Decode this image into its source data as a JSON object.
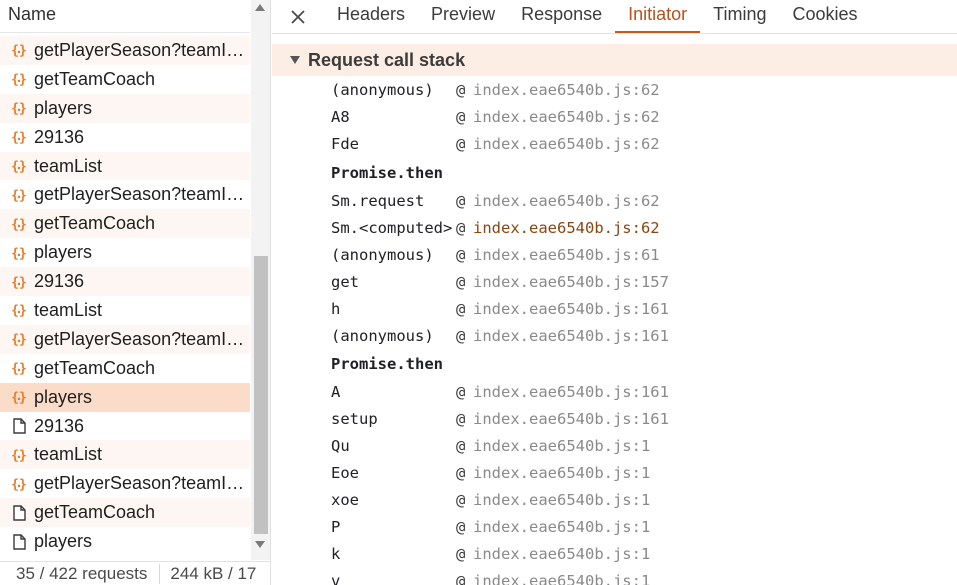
{
  "network": {
    "header": "Name",
    "requests": [
      {
        "name": "getPlayerSeason?teamId...",
        "icon": "json-icon"
      },
      {
        "name": "getTeamCoach",
        "icon": "json-icon"
      },
      {
        "name": "players",
        "icon": "json-icon"
      },
      {
        "name": "29136",
        "icon": "json-icon"
      },
      {
        "name": "teamList",
        "icon": "json-icon"
      },
      {
        "name": "getPlayerSeason?teamId...",
        "icon": "json-icon"
      },
      {
        "name": "getTeamCoach",
        "icon": "json-icon"
      },
      {
        "name": "players",
        "icon": "json-icon"
      },
      {
        "name": "29136",
        "icon": "json-icon"
      },
      {
        "name": "teamList",
        "icon": "json-icon"
      },
      {
        "name": "getPlayerSeason?teamId...",
        "icon": "json-icon"
      },
      {
        "name": "getTeamCoach",
        "icon": "json-icon"
      },
      {
        "name": "players",
        "icon": "json-icon",
        "selected": true
      },
      {
        "name": "29136",
        "icon": "document-icon"
      },
      {
        "name": "teamList",
        "icon": "json-icon"
      },
      {
        "name": "getPlayerSeason?teamId...",
        "icon": "json-icon"
      },
      {
        "name": "getTeamCoach",
        "icon": "document-icon"
      },
      {
        "name": "players",
        "icon": "document-icon"
      }
    ],
    "status": {
      "requests": "35 / 422 requests",
      "transferred": "244 kB / 17"
    }
  },
  "details": {
    "tabs": [
      "Headers",
      "Preview",
      "Response",
      "Initiator",
      "Timing",
      "Cookies"
    ],
    "active_tab": "Initiator",
    "section_title": "Request call stack",
    "call_stack": [
      {
        "fn": "(anonymous)",
        "loc": "index.eae6540b.js:62"
      },
      {
        "fn": "A8",
        "loc": "index.eae6540b.js:62"
      },
      {
        "fn": "Fde",
        "loc": "index.eae6540b.js:62"
      },
      {
        "async": "Promise.then"
      },
      {
        "fn": "Sm.request",
        "loc": "index.eae6540b.js:62"
      },
      {
        "fn": "Sm.<computed>",
        "loc": "index.eae6540b.js:62",
        "highlight": true
      },
      {
        "fn": "(anonymous)",
        "loc": "index.eae6540b.js:61"
      },
      {
        "fn": "get",
        "loc": "index.eae6540b.js:157"
      },
      {
        "fn": "h",
        "loc": "index.eae6540b.js:161"
      },
      {
        "fn": "(anonymous)",
        "loc": "index.eae6540b.js:161"
      },
      {
        "async": "Promise.then"
      },
      {
        "fn": "A",
        "loc": "index.eae6540b.js:161"
      },
      {
        "fn": "setup",
        "loc": "index.eae6540b.js:161"
      },
      {
        "fn": "Qu",
        "loc": "index.eae6540b.js:1"
      },
      {
        "fn": "Eoe",
        "loc": "index.eae6540b.js:1"
      },
      {
        "fn": "xoe",
        "loc": "index.eae6540b.js:1"
      },
      {
        "fn": "P",
        "loc": "index.eae6540b.js:1"
      },
      {
        "fn": "k",
        "loc": "index.eae6540b.js:1"
      },
      {
        "fn": "v",
        "loc": "index.eae6540b.js:1"
      }
    ],
    "at_symbol": "@"
  },
  "colors": {
    "accent": "#c4581f",
    "json_icon": "#e37e2e",
    "selected_row": "#fadcc8",
    "section_bg": "#fdeee5"
  }
}
